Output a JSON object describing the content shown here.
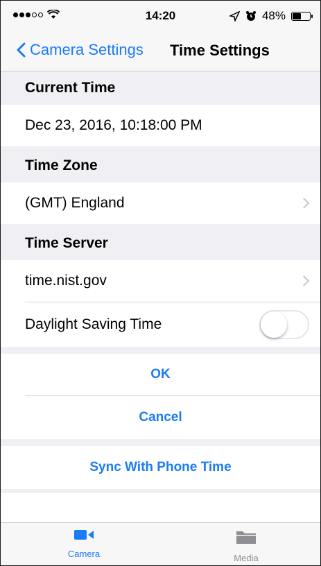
{
  "status_bar": {
    "time": "14:20",
    "battery": "48%"
  },
  "nav": {
    "back_label": "Camera Settings",
    "title": "Time Settings"
  },
  "sections": {
    "current_time": {
      "header": "Current Time",
      "value": "Dec 23, 2016, 10:18:00 PM"
    },
    "time_zone": {
      "header": "Time Zone",
      "value": "(GMT) England"
    },
    "time_server": {
      "header": "Time Server",
      "value": "time.nist.gov"
    },
    "daylight": {
      "label": "Daylight Saving Time",
      "enabled": false
    }
  },
  "actions": {
    "ok": "OK",
    "cancel": "Cancel",
    "sync": "Sync With Phone Time"
  },
  "tabs": [
    {
      "label": "Camera",
      "icon": "video-camera-icon",
      "active": true
    },
    {
      "label": "Media",
      "icon": "folder-icon",
      "active": false
    }
  ],
  "colors": {
    "accent": "#1a7cf5",
    "group_bg": "#efeff4",
    "inactive": "#8e8e93"
  }
}
